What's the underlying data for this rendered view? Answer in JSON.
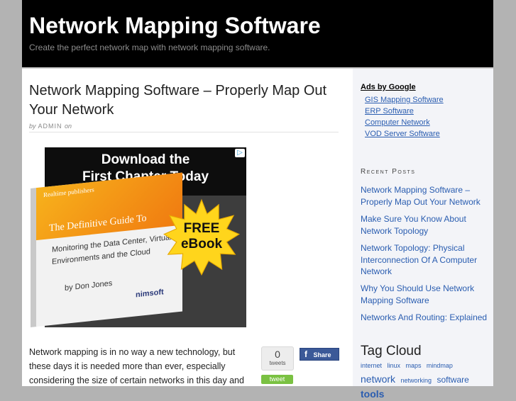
{
  "header": {
    "site_title": "Network Mapping Software",
    "site_description": "Create the perfect network map with network mapping software."
  },
  "post": {
    "title": "Network Mapping Software – Properly Map Out Your Network",
    "byline_by": "by",
    "byline_author": "ADMIN",
    "byline_on": "on",
    "body": "Network mapping is in no way a new technology, but these days it is needed more than ever, especially considering the size of certain networks in this day and"
  },
  "ad_banner": {
    "headline_line1": "Download the",
    "headline_line2": "First Chapter Today",
    "publisher": "Realtime publishers",
    "guide_title": "The Definitive Guide To",
    "subtitle": "Monitoring the Data Center, Virtual Environments and the Cloud",
    "author": "by Don Jones",
    "brand": "nimsoft",
    "badge_line1": "FREE",
    "badge_line2": "eBook",
    "adchoices_icon": "adchoices-icon"
  },
  "social": {
    "tweet_count": "0",
    "tweet_unit": "tweets",
    "tweet_button": "tweet",
    "facebook_share": "Share",
    "facebook_icon": "f",
    "tweet_color": "#7ac142",
    "facebook_color": "#3b5998"
  },
  "sidebar": {
    "ads_title": "Ads by Google",
    "ad_links": [
      "GIS Mapping Software",
      "ERP Software",
      "Computer Network",
      "VOD Server Software"
    ],
    "recent_posts_title": "Recent Posts",
    "recent_posts": [
      "Network Mapping Software – Properly Map Out Your Network",
      "Make Sure You Know About Network Topology",
      "Network Topology: Physical Interconnection Of A Computer Network",
      "Why You Should Use Network Mapping Software",
      "Networks And Routing: Explained"
    ],
    "tag_cloud_title": "Tag Cloud",
    "tags": [
      {
        "label": "internet",
        "weight": 1
      },
      {
        "label": "linux",
        "weight": 1
      },
      {
        "label": "maps",
        "weight": 1
      },
      {
        "label": "mindmap",
        "weight": 1
      },
      {
        "label": "network",
        "weight": 3
      },
      {
        "label": "networking",
        "weight": 1
      },
      {
        "label": "software",
        "weight": 2
      },
      {
        "label": "tools",
        "weight": 3
      }
    ],
    "link_color": "#2a5db0"
  }
}
